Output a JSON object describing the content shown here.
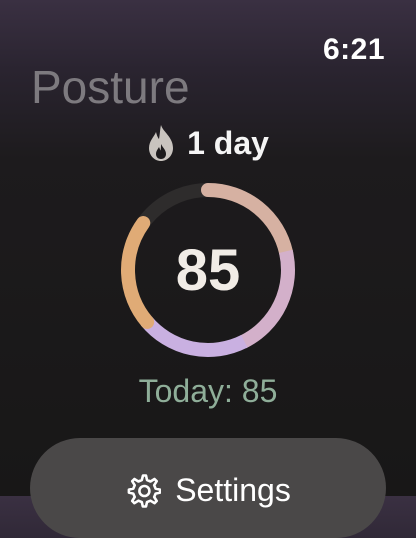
{
  "status_bar": {
    "time": "6:21"
  },
  "header": {
    "title": "Posture"
  },
  "streak": {
    "label": "1 day",
    "icon": "flame-icon"
  },
  "score_ring": {
    "value": "85",
    "fraction": 0.85,
    "segment_colors": [
      "#c9b0e1",
      "#d3b0ca",
      "#d6b1a2",
      "#e0ab76"
    ],
    "track_color": "#2e2c2c"
  },
  "today": {
    "label": "Today: 85"
  },
  "settings_button": {
    "label": "Settings",
    "icon": "gear-icon"
  }
}
